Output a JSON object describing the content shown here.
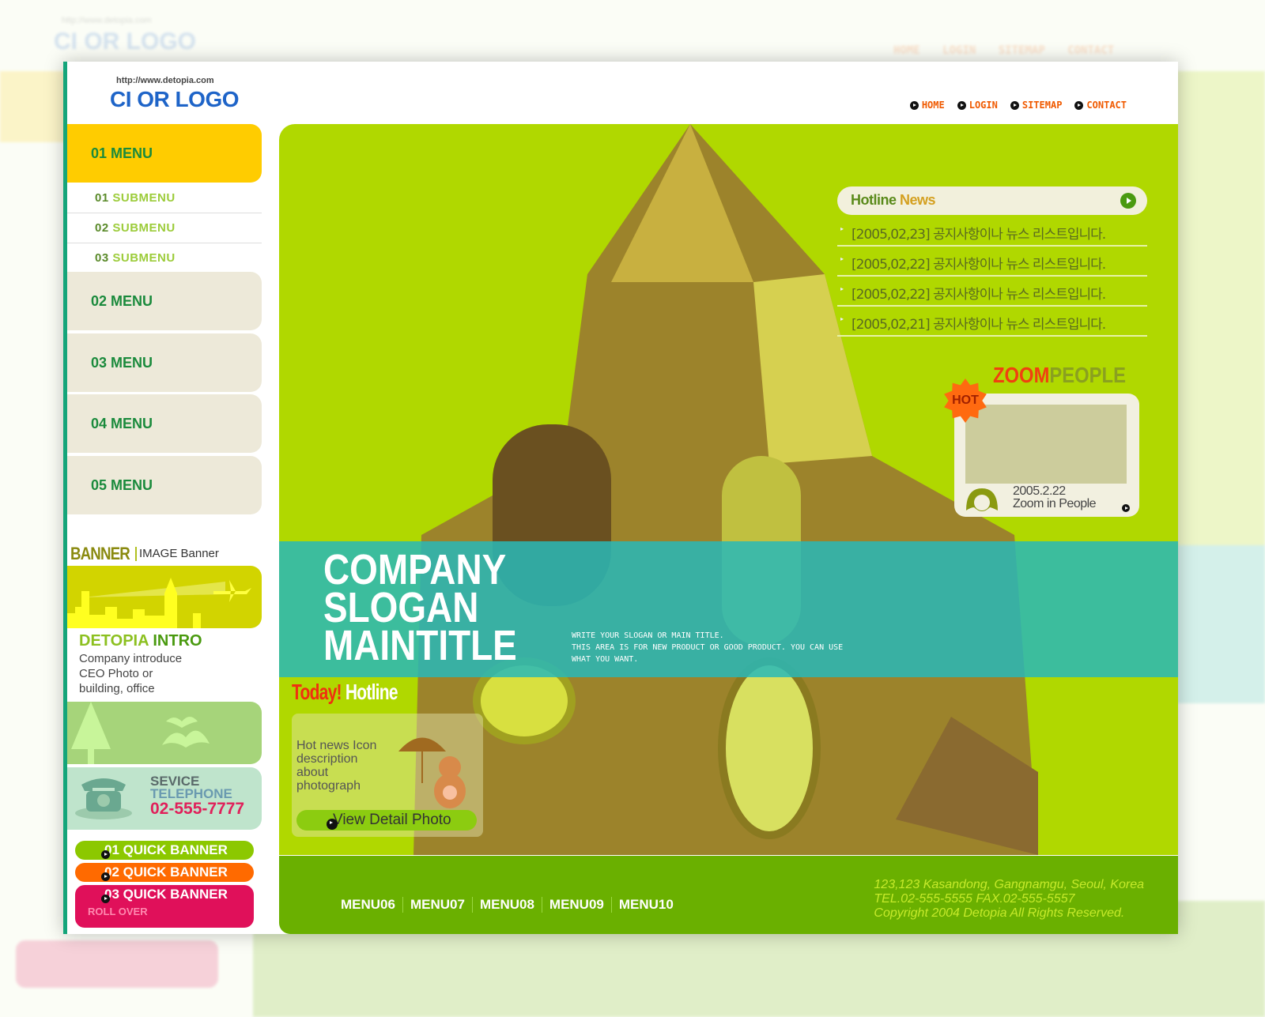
{
  "header": {
    "url": "http://www.detopia.com",
    "logo": "CI OR LOGO",
    "nav": [
      {
        "label": "HOME"
      },
      {
        "label": "LOGIN"
      },
      {
        "label": "SITEMAP"
      },
      {
        "label": "CONTACT"
      }
    ]
  },
  "sidebar": {
    "menus": [
      {
        "label": "01 MENU"
      },
      {
        "label": "02 MENU"
      },
      {
        "label": "03 MENU"
      },
      {
        "label": "04 MENU"
      },
      {
        "label": "05 MENU"
      }
    ],
    "submenus": [
      {
        "num": "01",
        "label": "SUBMENU"
      },
      {
        "num": "02",
        "label": "SUBMENU"
      },
      {
        "num": "03",
        "label": "SUBMENU"
      }
    ],
    "banner_title": "BANNER",
    "banner_subtitle": "IMAGE Banner",
    "intro_title_a": "DETOPIA",
    "intro_title_b": "INTRO",
    "intro_lines": [
      "Company introduce",
      "CEO Photo or",
      "building, office"
    ],
    "phone": {
      "l1": "SEVICE",
      "l2": "TELEPHONE",
      "number": "02-555-7777"
    },
    "quick": [
      {
        "label": "01 QUICK BANNER",
        "color": "#8cc800"
      },
      {
        "label": "02 QUICK BANNER",
        "color": "#ff6a00"
      },
      {
        "label": "03 QUICK BANNER",
        "color": "#e0105a",
        "sub": "ROLL OVER"
      }
    ]
  },
  "news": {
    "title_a": "Hotline",
    "title_b": "News",
    "items": [
      "[2005,02,23] 공지사항이나 뉴스 리스트입니다.",
      "[2005,02,22] 공지사항이나 뉴스 리스트입니다.",
      "[2005,02,22] 공지사항이나 뉴스 리스트입니다.",
      "[2005,02,21] 공지사항이나 뉴스 리스트입니다."
    ]
  },
  "zoom": {
    "title_a": "ZOOM",
    "title_b": "PEOPLE",
    "badge": "HOT",
    "date": "2005.2.22",
    "caption": "Zoom in People"
  },
  "hero": {
    "l1": "COMPANY",
    "l2": "SLOGAN",
    "l3": "MAINTITLE",
    "desc": [
      "WRITE YOUR SLOGAN OR MAIN TITLE.",
      "THIS AREA IS FOR NEW PRODUCT OR GOOD PRODUCT. YOU CAN USE",
      "WHAT YOU WANT."
    ]
  },
  "today": {
    "a": "Today!",
    "b": "Hotline",
    "desc": [
      "Hot news Icon",
      "description",
      "about",
      "photograph"
    ],
    "button": "View Detail Photo"
  },
  "footer": {
    "menus": [
      "MENU06",
      "MENU07",
      "MENU08",
      "MENU09",
      "MENU10"
    ],
    "address": [
      "123,123 Kasandong, Gangnamgu, Seoul, Korea",
      "TEL.02-555-5555  FAX.02-555-5557",
      "Copyright 2004 Detopia All Rights Reserved."
    ]
  },
  "colors": {
    "accent_green": "#b0d800",
    "teal": "#28b8b8",
    "orange": "#f05a00",
    "logo_blue": "#1e64c8"
  }
}
